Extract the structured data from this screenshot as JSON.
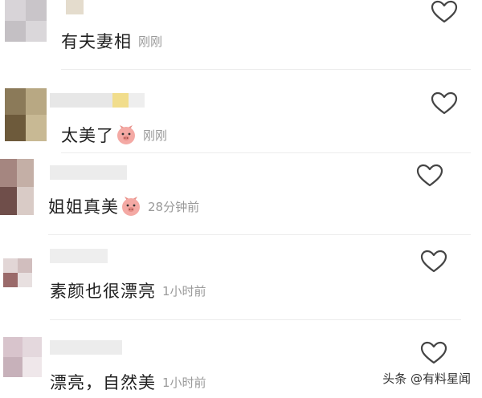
{
  "comments": [
    {
      "text": "有夫妻相",
      "emoji": false,
      "time": "刚刚"
    },
    {
      "text": "太美了",
      "emoji": true,
      "time": "刚刚"
    },
    {
      "text": "姐姐真美",
      "emoji": true,
      "time": "28分钟前"
    },
    {
      "text": "素颜也很漂亮",
      "emoji": false,
      "time": "1小时前"
    },
    {
      "text": "漂亮，自然美",
      "emoji": false,
      "time": "1小时前"
    }
  ],
  "icons": {
    "like": "heart-outline-icon",
    "emoji": "pig-face-emoji-icon"
  },
  "watermark": "头条 @有料星闻",
  "colors": {
    "text": "#1f1f1f",
    "time": "#9a9a9a",
    "icon_stroke": "#444444",
    "emoji_pink": "#f4a9a4"
  }
}
